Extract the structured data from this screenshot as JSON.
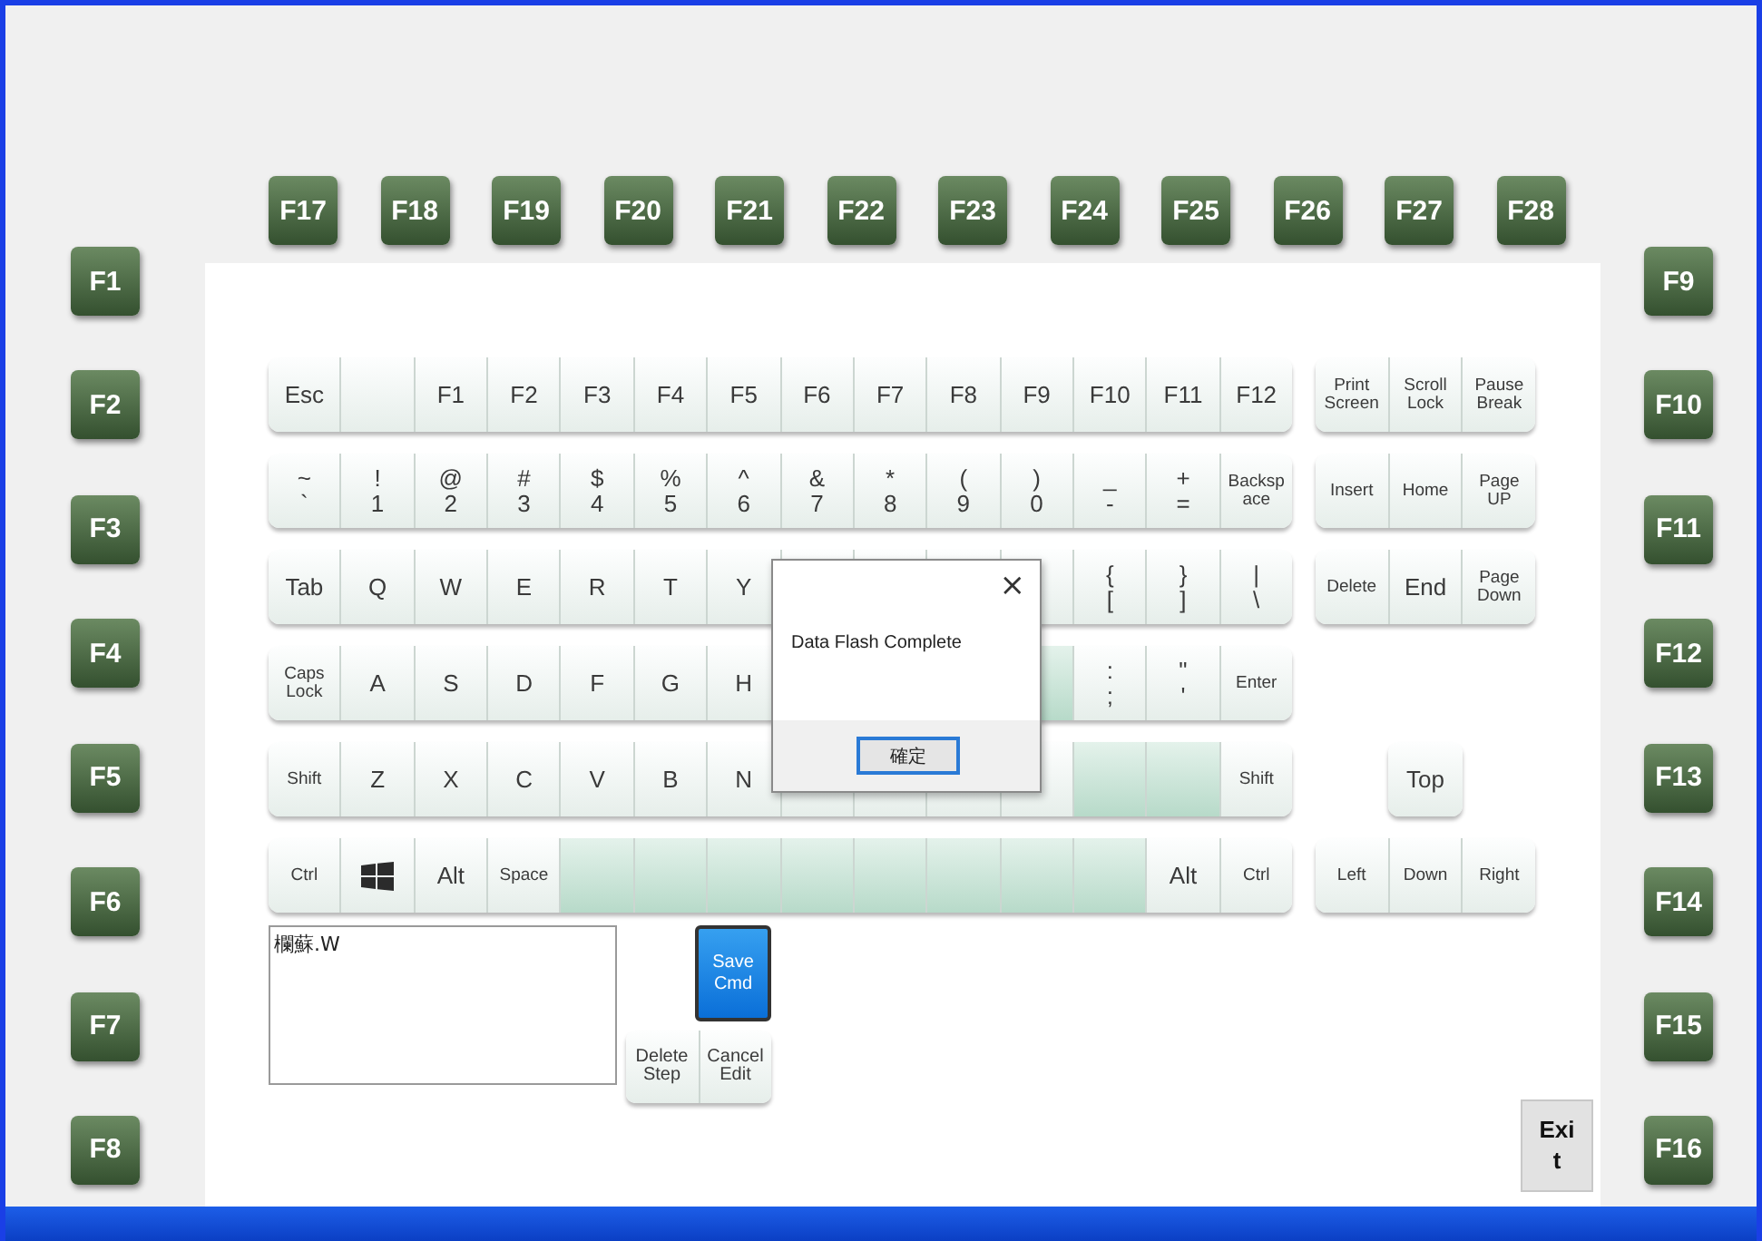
{
  "top_function_keys": [
    "F17",
    "F18",
    "F19",
    "F20",
    "F21",
    "F22",
    "F23",
    "F24",
    "F25",
    "F26",
    "F27",
    "F28"
  ],
  "left_function_keys": [
    "F1",
    "F2",
    "F3",
    "F4",
    "F5",
    "F6",
    "F7",
    "F8"
  ],
  "right_function_keys": [
    "F9",
    "F10",
    "F11",
    "F12",
    "F13",
    "F14",
    "F15",
    "F16"
  ],
  "keyboard": {
    "rows": [
      [
        {
          "kind": "key",
          "lines": [
            "Esc"
          ]
        },
        {
          "kind": "blank"
        },
        {
          "kind": "key",
          "lines": [
            "F1"
          ]
        },
        {
          "kind": "key",
          "lines": [
            "F2"
          ]
        },
        {
          "kind": "key",
          "lines": [
            "F3"
          ]
        },
        {
          "kind": "key",
          "lines": [
            "F4"
          ]
        },
        {
          "kind": "key",
          "lines": [
            "F5"
          ]
        },
        {
          "kind": "key",
          "lines": [
            "F6"
          ]
        },
        {
          "kind": "key",
          "lines": [
            "F7"
          ]
        },
        {
          "kind": "key",
          "lines": [
            "F8"
          ]
        },
        {
          "kind": "key",
          "lines": [
            "F9"
          ]
        },
        {
          "kind": "key",
          "lines": [
            "F10"
          ]
        },
        {
          "kind": "key",
          "lines": [
            "F11"
          ]
        },
        {
          "kind": "key",
          "lines": [
            "F12"
          ]
        }
      ],
      [
        {
          "kind": "key",
          "lines": [
            "~",
            "`"
          ]
        },
        {
          "kind": "key",
          "lines": [
            "!",
            "1"
          ]
        },
        {
          "kind": "key",
          "lines": [
            "@",
            "2"
          ]
        },
        {
          "kind": "key",
          "lines": [
            "#",
            "3"
          ]
        },
        {
          "kind": "key",
          "lines": [
            "$",
            "4"
          ]
        },
        {
          "kind": "key",
          "lines": [
            "%",
            "5"
          ]
        },
        {
          "kind": "key",
          "lines": [
            "^",
            "6"
          ]
        },
        {
          "kind": "key",
          "lines": [
            "&",
            "7"
          ]
        },
        {
          "kind": "key",
          "lines": [
            "*",
            "8"
          ]
        },
        {
          "kind": "key",
          "lines": [
            "(",
            "9"
          ]
        },
        {
          "kind": "key",
          "lines": [
            ")",
            "0"
          ]
        },
        {
          "kind": "key",
          "lines": [
            "_",
            "-"
          ]
        },
        {
          "kind": "key",
          "lines": [
            "+",
            "="
          ]
        },
        {
          "kind": "key",
          "lines": [
            "Backsp",
            "ace"
          ]
        }
      ],
      [
        {
          "kind": "key",
          "lines": [
            "Tab"
          ]
        },
        {
          "kind": "key",
          "lines": [
            "Q"
          ]
        },
        {
          "kind": "key",
          "lines": [
            "W"
          ]
        },
        {
          "kind": "key",
          "lines": [
            "E"
          ]
        },
        {
          "kind": "key",
          "lines": [
            "R"
          ]
        },
        {
          "kind": "key",
          "lines": [
            "T"
          ]
        },
        {
          "kind": "key",
          "lines": [
            "Y"
          ]
        },
        {
          "kind": "covered"
        },
        {
          "kind": "covered"
        },
        {
          "kind": "covered"
        },
        {
          "kind": "blank"
        },
        {
          "kind": "key",
          "lines": [
            "{",
            "["
          ]
        },
        {
          "kind": "key",
          "lines": [
            "}",
            "]"
          ]
        },
        {
          "kind": "key",
          "lines": [
            "|",
            "\\"
          ]
        }
      ],
      [
        {
          "kind": "key",
          "lines": [
            "Caps",
            "Lock"
          ]
        },
        {
          "kind": "key",
          "lines": [
            "A"
          ]
        },
        {
          "kind": "key",
          "lines": [
            "S"
          ]
        },
        {
          "kind": "key",
          "lines": [
            "D"
          ]
        },
        {
          "kind": "key",
          "lines": [
            "F"
          ]
        },
        {
          "kind": "key",
          "lines": [
            "G"
          ]
        },
        {
          "kind": "key",
          "lines": [
            "H"
          ]
        },
        {
          "kind": "covered"
        },
        {
          "kind": "covered"
        },
        {
          "kind": "covered"
        },
        {
          "kind": "accent"
        },
        {
          "kind": "key",
          "lines": [
            ":",
            ";"
          ]
        },
        {
          "kind": "key",
          "lines": [
            "\"",
            "'"
          ]
        },
        {
          "kind": "key",
          "lines": [
            "Enter"
          ]
        }
      ],
      [
        {
          "kind": "key",
          "lines": [
            "Shift"
          ]
        },
        {
          "kind": "key",
          "lines": [
            "Z"
          ]
        },
        {
          "kind": "key",
          "lines": [
            "X"
          ]
        },
        {
          "kind": "key",
          "lines": [
            "C"
          ]
        },
        {
          "kind": "key",
          "lines": [
            "V"
          ]
        },
        {
          "kind": "key",
          "lines": [
            "B"
          ]
        },
        {
          "kind": "key",
          "lines": [
            "N"
          ]
        },
        {
          "kind": "blank"
        },
        {
          "kind": "blank"
        },
        {
          "kind": "blank"
        },
        {
          "kind": "blank"
        },
        {
          "kind": "accent"
        },
        {
          "kind": "accent"
        },
        {
          "kind": "key",
          "lines": [
            "Shift"
          ]
        }
      ],
      [
        {
          "kind": "key",
          "lines": [
            "Ctrl"
          ]
        },
        {
          "kind": "windows"
        },
        {
          "kind": "key",
          "lines": [
            "Alt"
          ]
        },
        {
          "kind": "key",
          "lines": [
            "Space"
          ]
        },
        {
          "kind": "accent"
        },
        {
          "kind": "accent"
        },
        {
          "kind": "accent"
        },
        {
          "kind": "accent"
        },
        {
          "kind": "accent"
        },
        {
          "kind": "accent"
        },
        {
          "kind": "accent"
        },
        {
          "kind": "accent"
        },
        {
          "kind": "key",
          "lines": [
            "Alt"
          ]
        },
        {
          "kind": "key",
          "lines": [
            "Ctrl"
          ]
        }
      ]
    ]
  },
  "nav_cluster": {
    "rows": [
      [
        {
          "kind": "key",
          "lines": [
            "Print",
            "Screen"
          ]
        },
        {
          "kind": "key",
          "lines": [
            "Scroll",
            "Lock"
          ]
        },
        {
          "kind": "key",
          "lines": [
            "Pause",
            "Break"
          ]
        }
      ],
      [
        {
          "kind": "key",
          "lines": [
            "Insert"
          ]
        },
        {
          "kind": "key",
          "lines": [
            "Home"
          ]
        },
        {
          "kind": "key",
          "lines": [
            "Page",
            "UP"
          ]
        }
      ],
      [
        {
          "kind": "key",
          "lines": [
            "Delete"
          ]
        },
        {
          "kind": "key",
          "lines": [
            "End"
          ]
        },
        {
          "kind": "key",
          "lines": [
            "Page",
            "Down"
          ]
        }
      ],
      [
        {
          "kind": "none"
        },
        {
          "kind": "none"
        },
        {
          "kind": "none"
        }
      ],
      [
        {
          "kind": "none"
        },
        {
          "kind": "key",
          "lines": [
            "Top"
          ]
        },
        {
          "kind": "none"
        }
      ],
      [
        {
          "kind": "key",
          "lines": [
            "Left"
          ]
        },
        {
          "kind": "key",
          "lines": [
            "Down"
          ]
        },
        {
          "kind": "key",
          "lines": [
            "Right"
          ]
        }
      ]
    ]
  },
  "command_box": {
    "value": "欄蘇.W"
  },
  "save_button": {
    "lines": [
      "Save",
      "Cmd"
    ]
  },
  "step_buttons": [
    {
      "lines": [
        "Delete",
        "Step"
      ]
    },
    {
      "lines": [
        "Cancel",
        "Edit"
      ]
    }
  ],
  "exit_button": {
    "lines": [
      "Exi",
      "t"
    ]
  },
  "dialog": {
    "close": "×",
    "message": "Data Flash Complete",
    "ok": "確定"
  }
}
